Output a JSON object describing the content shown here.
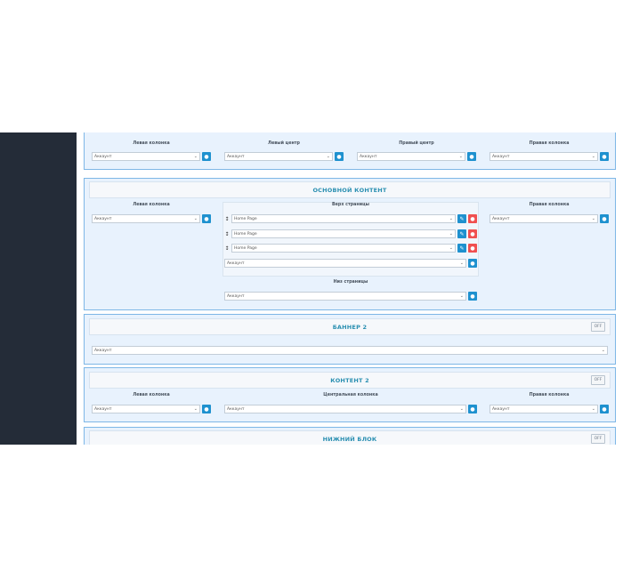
{
  "default_select": "Аккаунт",
  "sections": {
    "top": {
      "columns": [
        "Левая колонка",
        "Левый центр",
        "Правый центр",
        "Правая колонка"
      ]
    },
    "main": {
      "title": "ОСНОВНОЙ КОНТЕНТ",
      "left_label": "Левая колонка",
      "top_label": "Верх страницы",
      "right_label": "Правая колонка",
      "bottom_label": "Низ страницы",
      "module_items": [
        "Home Page",
        "Home Page",
        "Home Page"
      ]
    },
    "banner2": {
      "title": "БАННЕР 2",
      "off_label": "OFF"
    },
    "content2": {
      "title": "КОНТЕНТ 2",
      "off_label": "OFF",
      "columns": [
        "Левая колонка",
        "Центральная колонка",
        "Правая колонка"
      ]
    },
    "footer": {
      "title": "НИЖНИЙ БЛОК",
      "off_label": "OFF"
    }
  },
  "icons": {
    "add": "plus-circle-icon",
    "edit": "pencil-icon",
    "remove": "minus-circle-icon",
    "drag": "drag-handle-icon",
    "chevron": "chevron-down-icon"
  },
  "colors": {
    "sidebar": "#242c38",
    "section_bg": "#e8f2fd",
    "section_border": "#7eb7e6",
    "accent": "#1e91cf",
    "danger": "#f05050",
    "title": "#2a8fb1"
  }
}
